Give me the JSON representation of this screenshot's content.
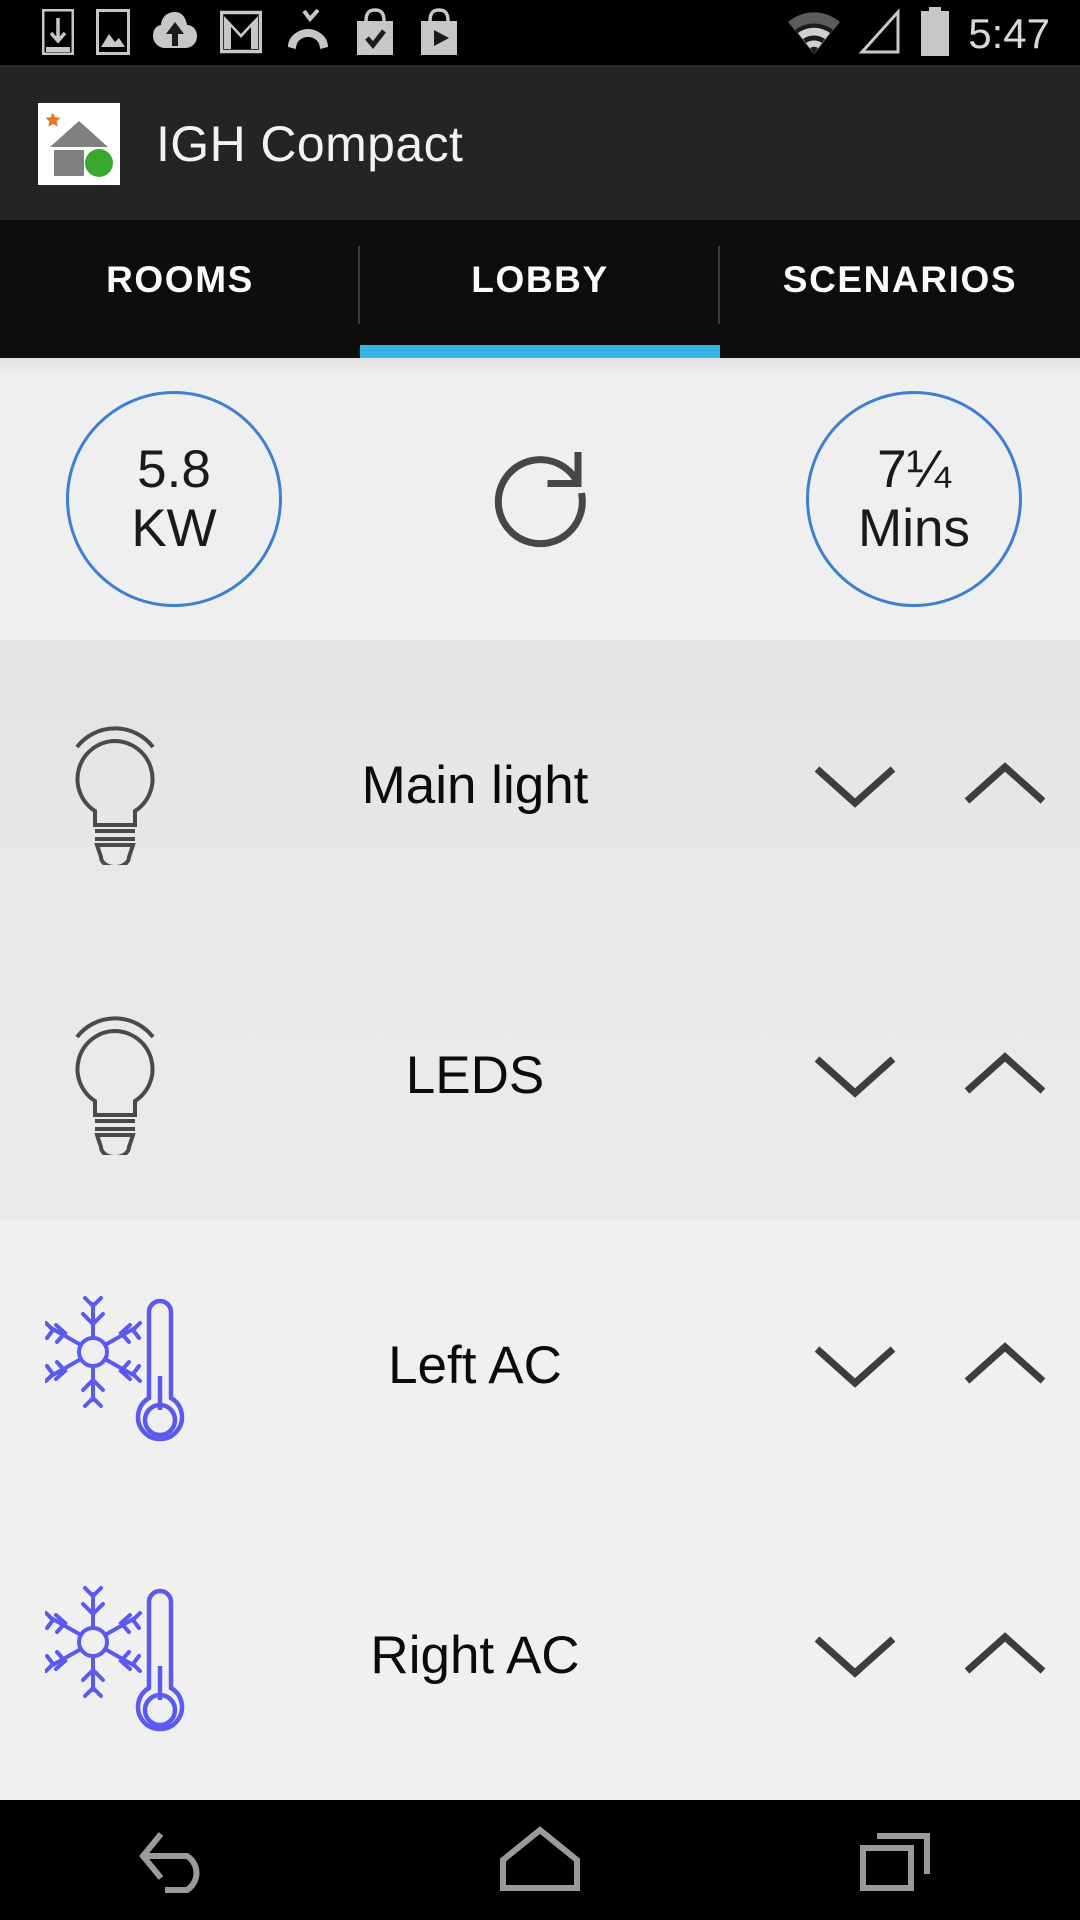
{
  "status_bar": {
    "time": "5:47",
    "left_icons": [
      {
        "name": "download-manager-icon"
      },
      {
        "name": "photo-icon"
      },
      {
        "name": "cloud-upload-icon"
      },
      {
        "name": "gmail-icon"
      },
      {
        "name": "missed-call-icon"
      },
      {
        "name": "play-store-update-icon"
      },
      {
        "name": "play-store-icon"
      }
    ],
    "right_icons": [
      {
        "name": "wifi-icon"
      },
      {
        "name": "cellular-signal-icon"
      },
      {
        "name": "battery-icon"
      }
    ]
  },
  "action_bar": {
    "title": "IGH Compact",
    "icon_name": "igh-compact-app-icon",
    "colors": {
      "background": "#242424",
      "star": "#e8762a",
      "house": "#808080",
      "dot": "#3aa82d"
    }
  },
  "tabs": {
    "active_index": 1,
    "accent_color": "#33b5e5",
    "items": [
      {
        "label": "ROOMS"
      },
      {
        "label": "LOBBY"
      },
      {
        "label": "SCENARIOS"
      }
    ]
  },
  "summary": {
    "power": {
      "value": "5.8",
      "unit": "KW",
      "icon_name": "power-gauge"
    },
    "refresh": {
      "icon_name": "refresh-icon"
    },
    "runtime": {
      "value": "7¼",
      "unit": "Mins",
      "icon_name": "runtime-gauge"
    },
    "circle_color": "#3d7fd0"
  },
  "devices": [
    {
      "label": "Main light",
      "icon_name": "light-bulb-icon",
      "icon_type": "bulb",
      "icon_color": "#4a4a4a",
      "down_label": "decrease",
      "up_label": "increase"
    },
    {
      "label": "LEDS",
      "icon_name": "light-bulb-icon",
      "icon_type": "bulb",
      "icon_color": "#4a4a4a",
      "down_label": "decrease",
      "up_label": "increase"
    },
    {
      "label": "Left AC",
      "icon_name": "ac-cooling-icon",
      "icon_type": "ac",
      "icon_color": "#5a5af0",
      "down_label": "decrease",
      "up_label": "increase"
    },
    {
      "label": "Right AC",
      "icon_name": "ac-cooling-icon",
      "icon_type": "ac",
      "icon_color": "#5a5af0",
      "down_label": "decrease",
      "up_label": "increase"
    }
  ],
  "nav_bar": {
    "items": [
      {
        "name": "back-button",
        "label": "Back"
      },
      {
        "name": "home-button",
        "label": "Home"
      },
      {
        "name": "recents-button",
        "label": "Recent apps"
      }
    ]
  }
}
